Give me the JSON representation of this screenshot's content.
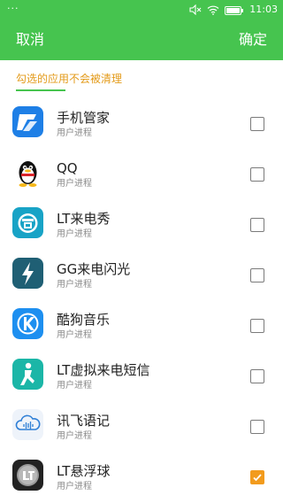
{
  "status_bar": {
    "dots": "···",
    "time": "11:03",
    "icons": [
      "mute-icon",
      "wifi-icon",
      "battery-icon"
    ]
  },
  "header": {
    "cancel_label": "取消",
    "confirm_label": "确定",
    "background_color": "#46c44f"
  },
  "section": {
    "title": "勾选的应用不会被清理",
    "title_color": "#e39a18"
  },
  "apps": [
    {
      "name": "手机管家",
      "type": "用户进程",
      "icon": "phone-manager-icon",
      "checked": false
    },
    {
      "name": "QQ",
      "type": "用户进程",
      "icon": "qq-penguin-icon",
      "checked": false
    },
    {
      "name": "LT来电秀",
      "type": "用户进程",
      "icon": "lt-call-show-icon",
      "checked": false
    },
    {
      "name": "GG来电闪光",
      "type": "用户进程",
      "icon": "lightning-icon",
      "checked": false
    },
    {
      "name": "酷狗音乐",
      "type": "用户进程",
      "icon": "kugou-music-icon",
      "checked": false
    },
    {
      "name": "LT虚拟来电短信",
      "type": "用户进程",
      "icon": "running-person-icon",
      "checked": false
    },
    {
      "name": "讯飞语记",
      "type": "用户进程",
      "icon": "cloud-voice-icon",
      "checked": false
    },
    {
      "name": "LT悬浮球",
      "type": "用户进程",
      "icon": "floating-ball-icon",
      "checked": true
    }
  ],
  "check_color": "#f29b1d"
}
